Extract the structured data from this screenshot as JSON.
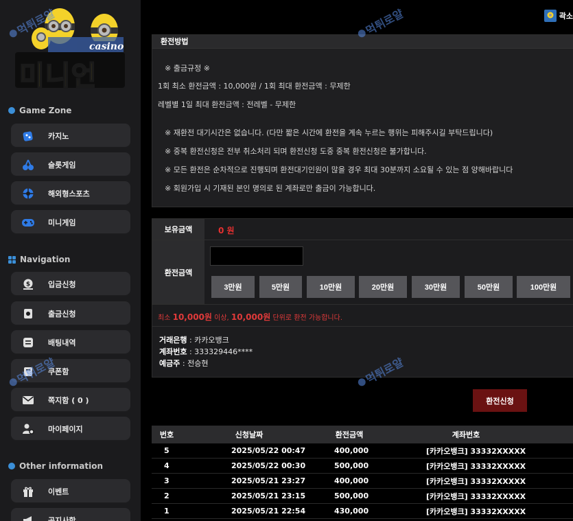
{
  "brand": {
    "casino_label": "casino",
    "name": "미니언"
  },
  "sidebar": {
    "sections": [
      {
        "title": "Game Zone"
      },
      {
        "title": "Navigation"
      },
      {
        "title": "Other information"
      }
    ],
    "game_items": [
      {
        "label": "카지노",
        "icon": "dice-icon"
      },
      {
        "label": "슬롯게임",
        "icon": "cherry-icon"
      },
      {
        "label": "해외형스포츠",
        "icon": "ball-icon"
      },
      {
        "label": "미니게임",
        "icon": "gamepad-icon"
      }
    ],
    "nav_items": [
      {
        "label": "입금신청",
        "icon": "money-bag-icon"
      },
      {
        "label": "출금신청",
        "icon": "wallet-icon"
      },
      {
        "label": "배팅내역",
        "icon": "list-icon"
      },
      {
        "label": "쿠폰함",
        "icon": "coupon-icon"
      },
      {
        "label": "쪽지함 ( 0 )",
        "icon": "envelope-icon"
      },
      {
        "label": "마이페이지",
        "icon": "user-gear-icon"
      }
    ],
    "other_items": [
      {
        "label": "이벤트",
        "icon": "gift-icon"
      },
      {
        "label": "공지사항",
        "icon": "megaphone-icon"
      }
    ]
  },
  "topbar": {
    "user_text": "곽소"
  },
  "method": {
    "title": "환전방법",
    "lines": [
      "※ 출금규정 ※",
      "1회 최소 환전금액 : 10,000원 / 1회 최대 환전금액 : 무제한",
      "레벨별 1일 최대 환전금액 : 전레벨 - 무제한",
      "※ 재환전 대기시간은 없습니다. (다만 짧은 시간에 환전을 계속 누르는 행위는 피해주시길 부탁드립니다)",
      "※ 중복 환전신청은 전부 취소처리 되며 환전신청 도중 중복 환전신청은 불가합니다.",
      "※ 모든 환전은 순차적으로 진행되며 환전대기인원이 많을 경우 최대 30분까지 소요될 수 있는 점 양해바랍니다",
      "※ 회원가입 시 기재된 본인 명의로 된 계좌로만 출금이 가능합니다."
    ]
  },
  "amount": {
    "held_label": "보유금액",
    "held_value": "0 원",
    "exchange_label": "환전금액",
    "input_value": "",
    "buttons": [
      "3만원",
      "5만원",
      "10만원",
      "20만원",
      "30만원",
      "50만원",
      "100만원"
    ],
    "notice_prefix": "최소",
    "notice_min": "10,000원",
    "notice_mid": "이상,",
    "notice_unit": "10,000원",
    "notice_suffix": "단위로 환전 가능합니다.",
    "bank_label": "거래은행",
    "bank_value": " : 카카오뱅크",
    "account_label": "계좌번호",
    "account_value": " : 333329446****",
    "holder_label": "예금주",
    "holder_value": " : 전승현"
  },
  "submit_label": "환전신청",
  "history": {
    "headers": [
      "번호",
      "신청날짜",
      "환전금액",
      "계좌번호"
    ],
    "rows": [
      {
        "no": "5",
        "date": "2025/05/22 00:47",
        "amount": "400,000",
        "account": "[카카오뱅크] 33332XXXXX"
      },
      {
        "no": "4",
        "date": "2025/05/22 00:30",
        "amount": "500,000",
        "account": "[카카오뱅크] 33332XXXXX"
      },
      {
        "no": "3",
        "date": "2025/05/21 23:27",
        "amount": "400,000",
        "account": "[카카오뱅크] 33332XXXXX"
      },
      {
        "no": "2",
        "date": "2025/05/21 23:15",
        "amount": "500,000",
        "account": "[카카오뱅크] 33332XXXXX"
      },
      {
        "no": "1",
        "date": "2025/05/21 22:54",
        "amount": "430,000",
        "account": "[카카오뱅크] 33332XXXXX"
      }
    ]
  },
  "watermark_text": "먹튀로얄",
  "colors": {
    "accent_red": "#e53030",
    "submit_bg": "#6a1212",
    "section_dot": "#3b8fd8"
  }
}
